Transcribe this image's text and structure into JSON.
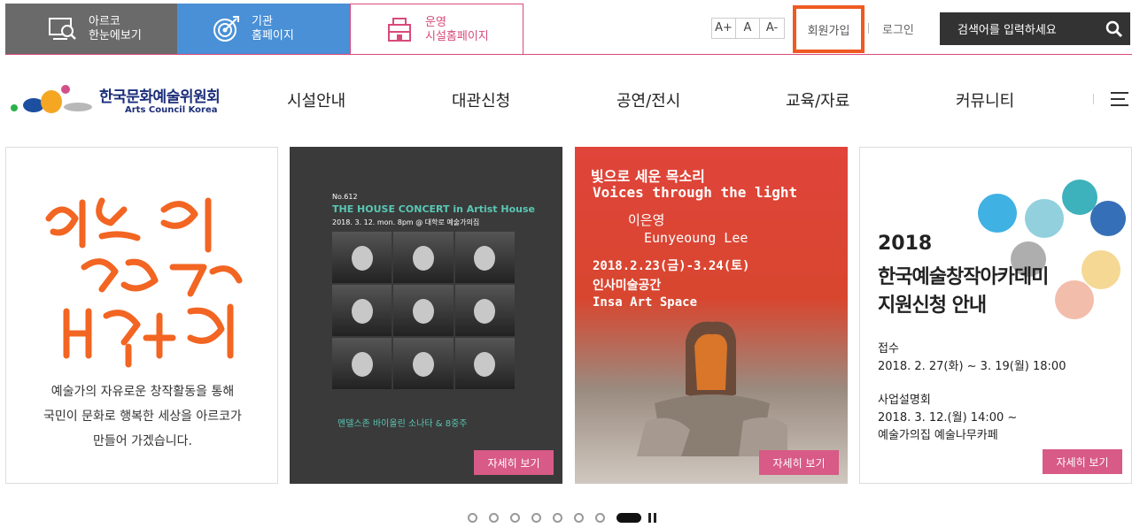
{
  "topbar": {
    "tabs": [
      {
        "line1": "아르코",
        "line2": "한눈에보기",
        "icon": "screen-search-icon"
      },
      {
        "line1": "기관",
        "line2": "홈페이지",
        "icon": "target-icon"
      },
      {
        "line1": "운영",
        "line2": "시설홈페이지",
        "icon": "building-icon"
      }
    ],
    "font_controls": [
      "A+",
      "A",
      "A-"
    ],
    "join_label": "회원가입",
    "login_label": "로그인",
    "search_placeholder": "검색어를 입력하세요",
    "accent_color": "#d84a7a",
    "highlight_color": "#ee5a22"
  },
  "header": {
    "logo_ko": "한국문화예술위원회",
    "logo_en": "Arts Council Korea",
    "nav": [
      "시설안내",
      "대관신청",
      "공연/전시",
      "교육/자료",
      "커뮤니티"
    ],
    "menu_icon": "hamburger-icon"
  },
  "slides": {
    "card1": {
      "calligraphy": "예술이 세상을 바꿉니다",
      "desc1": "예술가의 자유로운 창작활동을 통해",
      "desc2": "국민이 문화로 행복한 세상을 아르코가",
      "desc3": "만들어 가겠습니다."
    },
    "card2": {
      "no": "No.612",
      "title": "THE HOUSE CONCERT in Artist House",
      "sub": "2018. 3. 12. mon. 8pm @ 대학로 예술가의집",
      "caption": "멘델스존 바이올린 소나타 & 8중주",
      "more": "자세히 보기"
    },
    "card3": {
      "t1": "빛으로 세운 목소리",
      "t2": "Voices through the light",
      "t3": "이은영",
      "t4": "Eunyeoung Lee",
      "t5": "2018.2.23(금)-3.24(토)",
      "t6": "인사미술공간",
      "t7": "Insa Art Space",
      "more": "자세히 보기"
    },
    "card4": {
      "year": "2018",
      "title1": "한국예술창작아카데미",
      "title2": "지원신청 안내",
      "l1": "접수",
      "l2": "2018. 2. 27(화) ~ 3. 19(월) 18:00",
      "l3": "사업설명회",
      "l4": "2018. 3. 12.(월) 14:00 ~",
      "l5": "예술가의집 예술나무카페",
      "more": "자세히 보기"
    }
  },
  "pager": {
    "dots": 7,
    "active_index": 7
  }
}
